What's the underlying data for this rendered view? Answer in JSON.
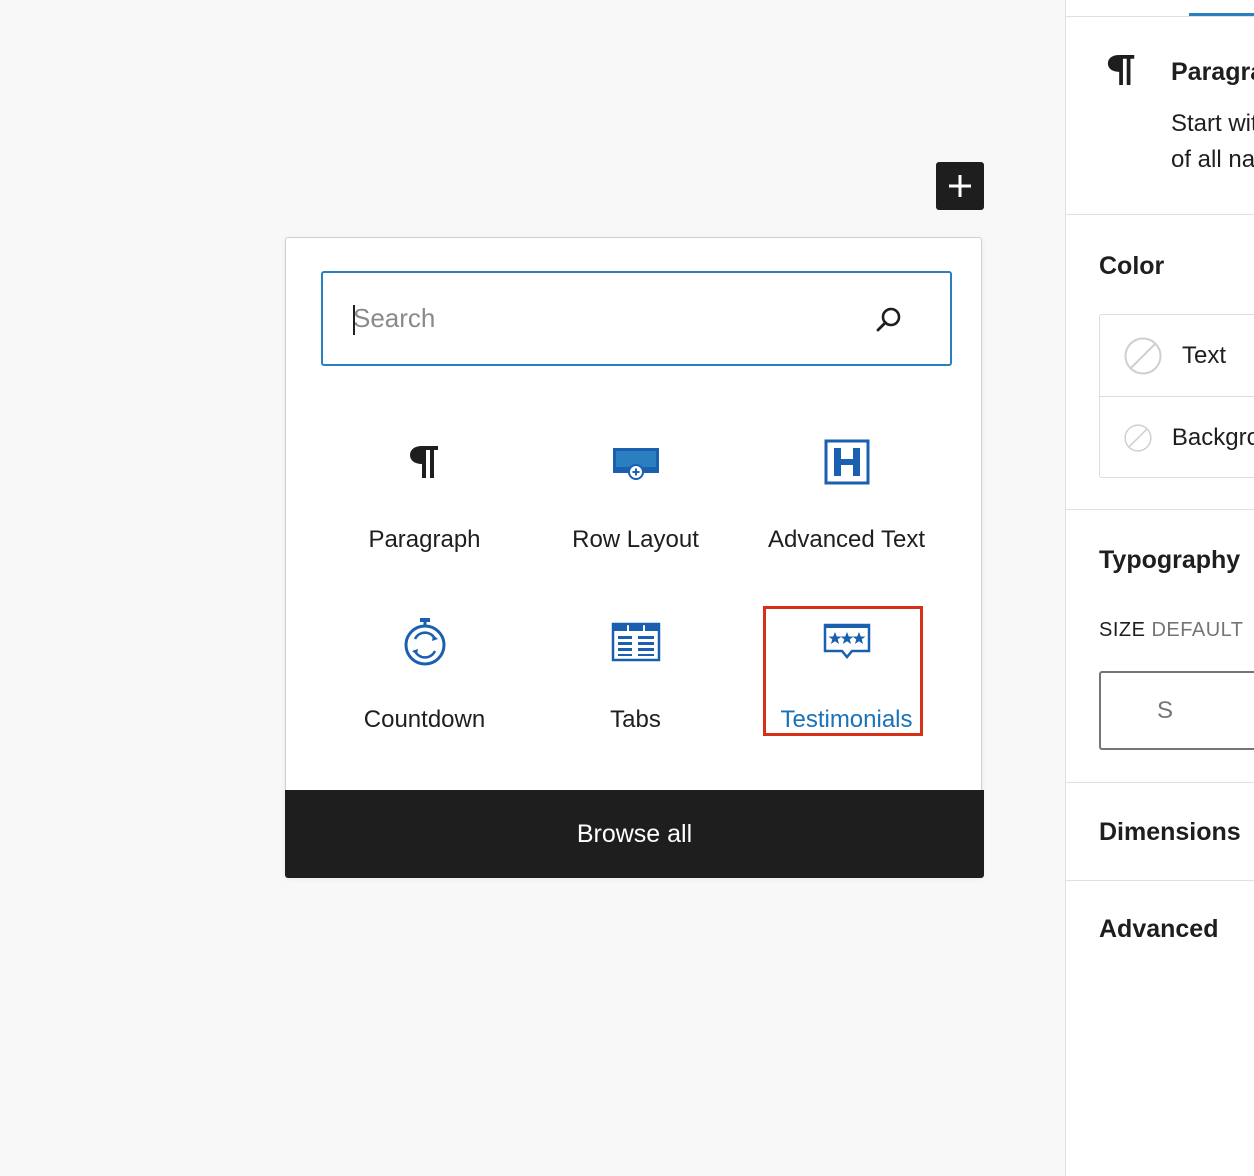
{
  "inserter": {
    "toggle_label": "+",
    "search": {
      "placeholder": "Search",
      "value": ""
    },
    "blocks": [
      {
        "label": "Paragraph",
        "icon": "paragraph-icon"
      },
      {
        "label": "Row Layout",
        "icon": "row-layout-icon"
      },
      {
        "label": "Advanced Text",
        "icon": "advanced-text-icon"
      },
      {
        "label": "Countdown",
        "icon": "countdown-icon"
      },
      {
        "label": "Tabs",
        "icon": "tabs-icon"
      },
      {
        "label": "Testimonials",
        "icon": "testimonials-icon",
        "selected": true
      }
    ],
    "browse_all": "Browse all"
  },
  "sidebar": {
    "block_card": {
      "icon": "paragraph-icon",
      "title": "Paragraph",
      "description_line1": "Start with the building block",
      "description_line2": "of all narrative."
    },
    "color": {
      "title": "Color",
      "items": [
        {
          "label": "Text"
        },
        {
          "label": "Background"
        }
      ]
    },
    "typography": {
      "title": "Typography",
      "size_label": "SIZE",
      "size_value": "DEFAULT",
      "size_option": "S"
    },
    "dimensions": {
      "title": "Dimensions"
    },
    "advanced": {
      "title": "Advanced"
    }
  },
  "colors": {
    "accent": "#2a7fc0",
    "icon_blue": "#1a5fb0",
    "highlight": "#d63118",
    "dark": "#1e1e1e"
  }
}
